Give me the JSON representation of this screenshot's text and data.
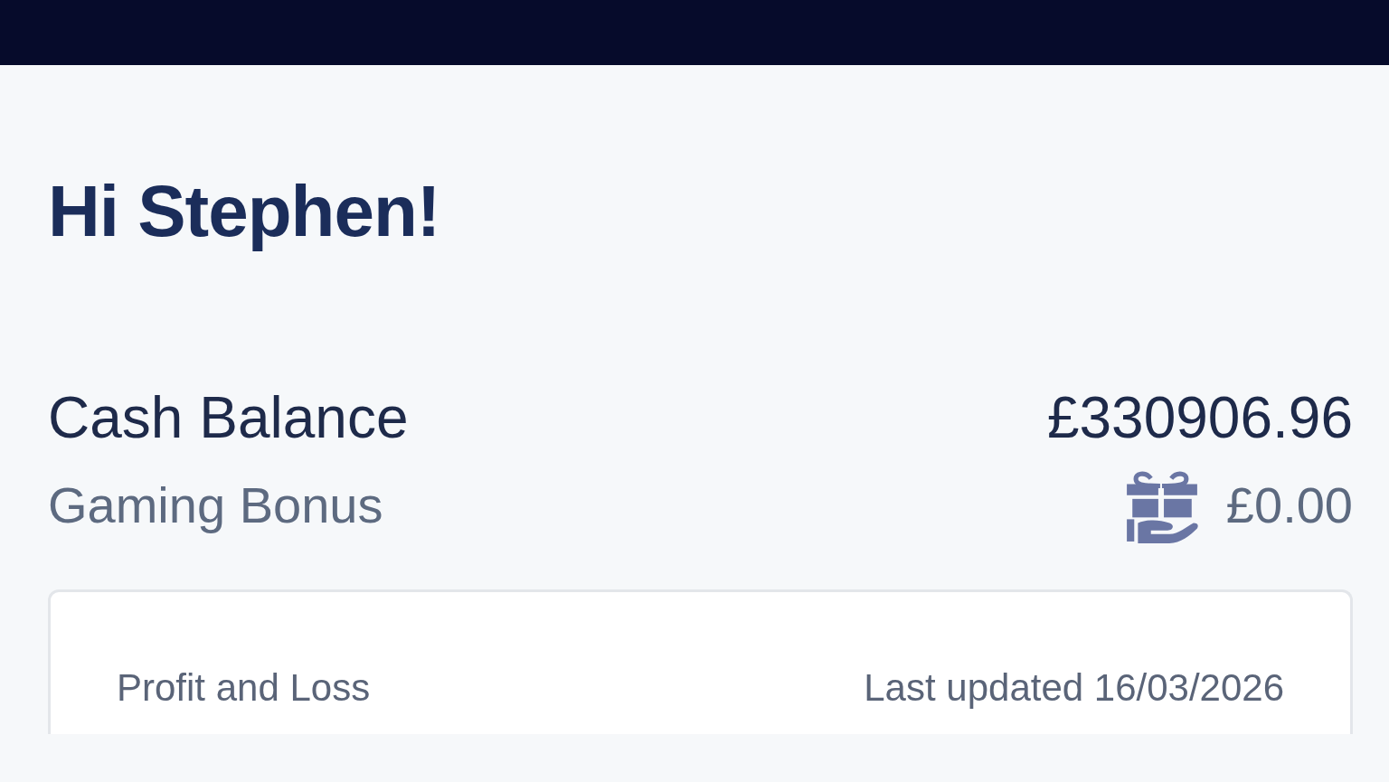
{
  "greeting": "Hi Stephen!",
  "balances": [
    {
      "label": "Cash Balance",
      "value": "£330906.96",
      "kind": "cash"
    },
    {
      "label": "Gaming Bonus",
      "value": "£0.00",
      "kind": "bonus"
    }
  ],
  "card": {
    "title": "Profit and Loss",
    "updated": "Last updated 16/03/2026"
  }
}
